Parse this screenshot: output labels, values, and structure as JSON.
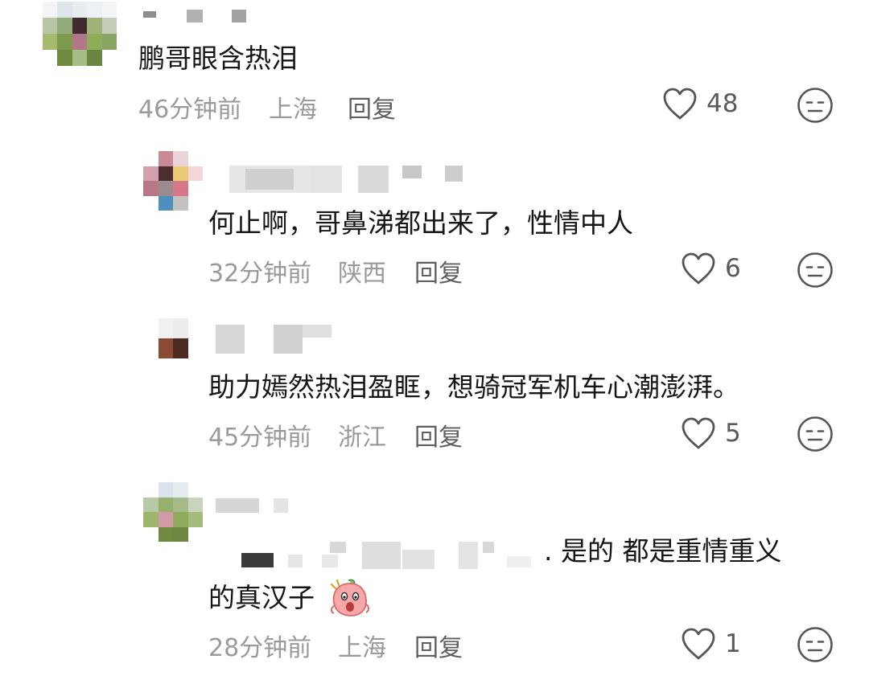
{
  "comments": [
    {
      "content": "鹏哥眼含热泪",
      "time": "46分钟前",
      "location": "上海",
      "reply": "回复",
      "likes": "48"
    },
    {
      "content": "何止啊，哥鼻涕都出来了，性情中人",
      "time": "32分钟前",
      "location": "陕西",
      "reply": "回复",
      "likes": "6"
    },
    {
      "content": "助力嫣然热泪盈眶，想骑冠军机车心潮澎湃。",
      "time": "45分钟前",
      "location": "浙江",
      "reply": "回复",
      "likes": "5"
    },
    {
      "content_line1": ". 是的 都是重情重义",
      "content_line2": "的真汉子",
      "time": "28分钟前",
      "location": "上海",
      "reply": "回复",
      "likes": "1"
    }
  ],
  "icons": {
    "like": "heart-outline-icon",
    "dislike": "meh-face-icon",
    "emoji": "shocked-peach-emoji"
  },
  "colors": {
    "meta": "#9a9a9a",
    "reply": "#5f5f5f",
    "text": "#161616",
    "icon": "#555555"
  }
}
